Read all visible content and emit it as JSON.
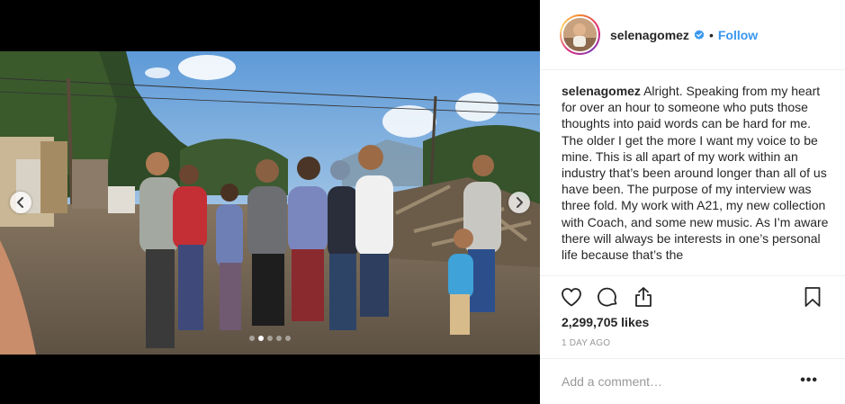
{
  "post": {
    "author": {
      "username": "selenagomez",
      "verified": true
    },
    "separator": "•",
    "follow_label": "Follow",
    "caption_user": "selenagomez",
    "caption_text": "Alright. Speaking from my heart for over an hour to someone who puts those thoughts into paid words can be hard for me. The older I get the more I want my voice to be mine. This is all apart of my work within an industry that’s been around longer than all of us have been. The purpose of my interview was three fold. My work with A21, my new collection with Coach, and some new music. As I’m aware there will always be interests in one’s personal life because that’s the",
    "likes": "2,299,705 likes",
    "time_ago": "1 DAY AGO",
    "comment_placeholder": "Add a comment…",
    "more_label": "•••"
  },
  "carousel": {
    "slide_count": 5,
    "active_slide": 1
  },
  "icons": {
    "prev": "chevron-left-icon",
    "next": "chevron-right-icon",
    "like": "heart-icon",
    "comment": "comment-bubble-icon",
    "share": "share-icon",
    "save": "bookmark-icon",
    "verified": "verified-badge-icon"
  },
  "colors": {
    "link": "#3897f0",
    "text": "#262626",
    "muted": "#999999",
    "verified": "#3897f0"
  }
}
